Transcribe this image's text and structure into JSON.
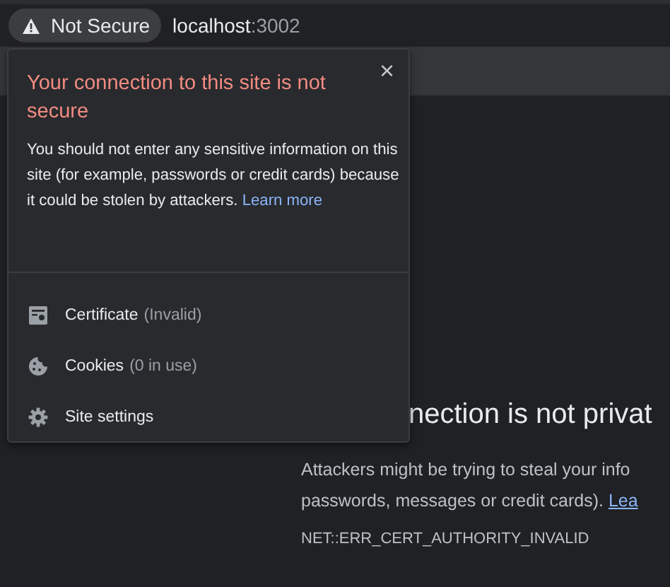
{
  "address_bar": {
    "security_chip": "Not Secure",
    "host": "localhost",
    "port": ":3002"
  },
  "popup": {
    "close": "×",
    "title": "Your connection to this site is not secure",
    "body": "You should not enter any sensitive information on this site (for example, passwords or credit cards) because it could be stolen by attackers.",
    "link": "Learn more",
    "items": [
      {
        "kind": "certificate",
        "label": "Certificate",
        "detail": "(Invalid)"
      },
      {
        "kind": "cookies",
        "label": "Cookies",
        "detail": "(0 in use)"
      },
      {
        "kind": "settings",
        "label": "Site settings"
      }
    ]
  },
  "page": {
    "heading": "nection is not privat",
    "lines": [
      "Attackers might be trying to steal your info",
      "passwords, messages or credit cards)."
    ],
    "link": "Lea",
    "error_code": "NET::ERR_CERT_AUTHORITY_INVALID"
  }
}
